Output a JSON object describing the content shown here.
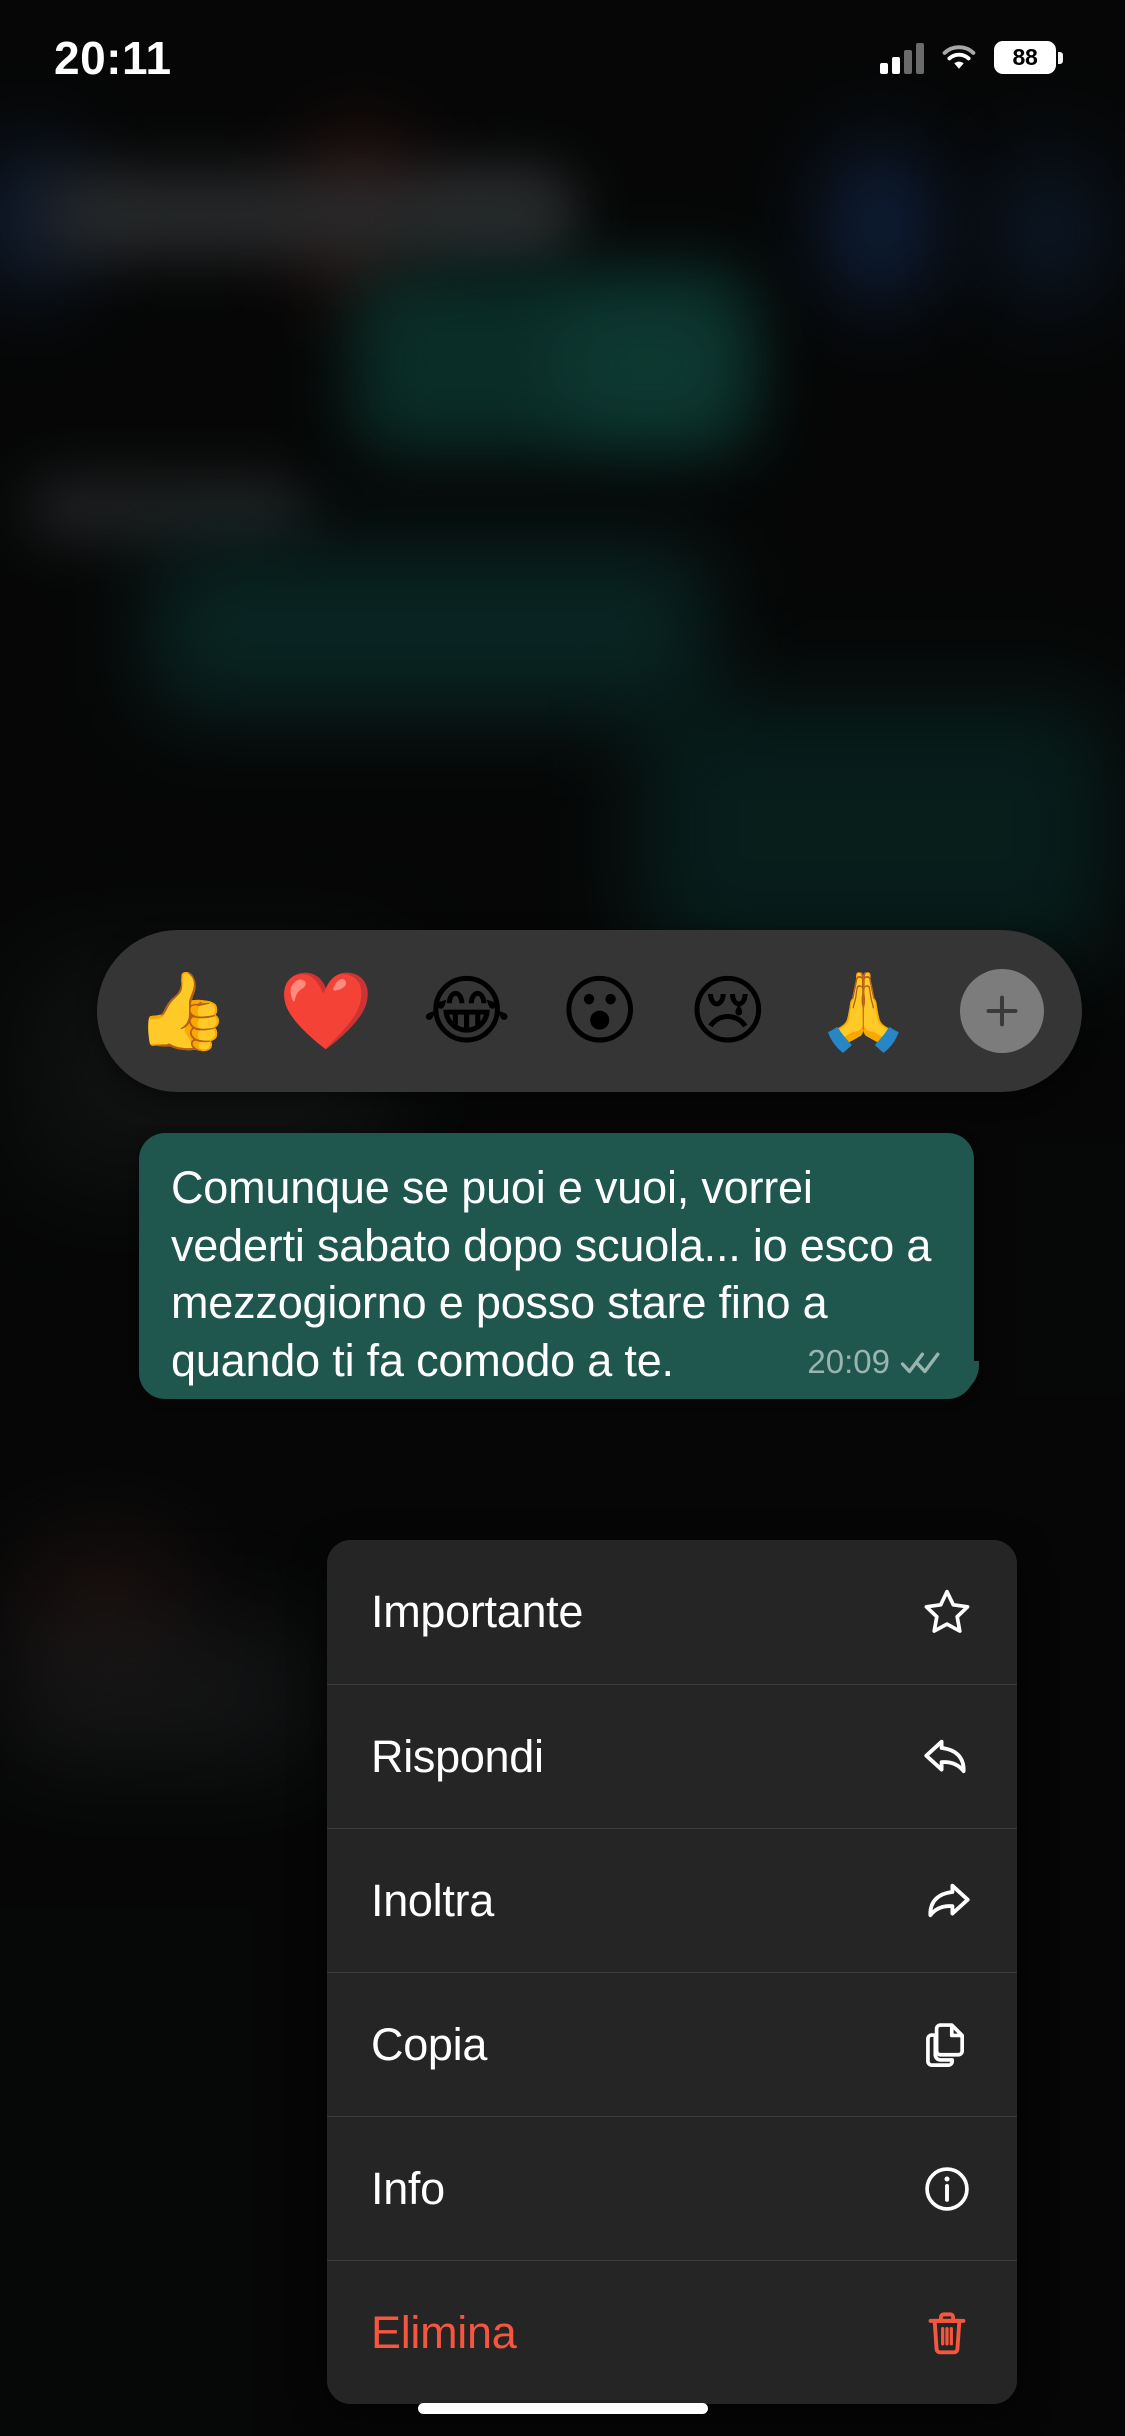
{
  "status_bar": {
    "time": "20:11",
    "battery_level": "88",
    "signal_icon": "cellular-signal-icon",
    "wifi_icon": "wifi-icon",
    "battery_icon": "battery-icon"
  },
  "reaction_bar": {
    "reactions": [
      {
        "name": "thumbs-up-reaction",
        "glyph": "👍"
      },
      {
        "name": "heart-reaction",
        "glyph": "❤️"
      },
      {
        "name": "tears-of-joy-reaction",
        "glyph": "😂"
      },
      {
        "name": "open-mouth-reaction",
        "glyph": "😮"
      },
      {
        "name": "crying-face-reaction",
        "glyph": "😢"
      },
      {
        "name": "folded-hands-reaction",
        "glyph": "🙏"
      }
    ],
    "more_button": {
      "name": "add-reaction-button",
      "icon": "plus-icon"
    }
  },
  "message": {
    "text": "Comunque se puoi e vuoi, vorrei vederti sabato dopo scuola... io esco a mezzogiorno e posso stare fino a quando ti fa comodo a te.",
    "time": "20:09",
    "status_icon": "double-check-icon",
    "bubble_color": "#1f564d",
    "outgoing": "true"
  },
  "context_menu": {
    "items": [
      {
        "label": "Importante",
        "icon": "star-icon",
        "destructive": false
      },
      {
        "label": "Rispondi",
        "icon": "reply-icon",
        "destructive": false
      },
      {
        "label": "Inoltra",
        "icon": "forward-icon",
        "destructive": false
      },
      {
        "label": "Copia",
        "icon": "copy-icon",
        "destructive": false
      },
      {
        "label": "Info",
        "icon": "info-circle-icon",
        "destructive": false
      },
      {
        "label": "Elimina",
        "icon": "trash-icon",
        "destructive": true
      }
    ],
    "destructive_color": "#f4563e"
  },
  "home_indicator": {
    "name": "home-indicator"
  }
}
